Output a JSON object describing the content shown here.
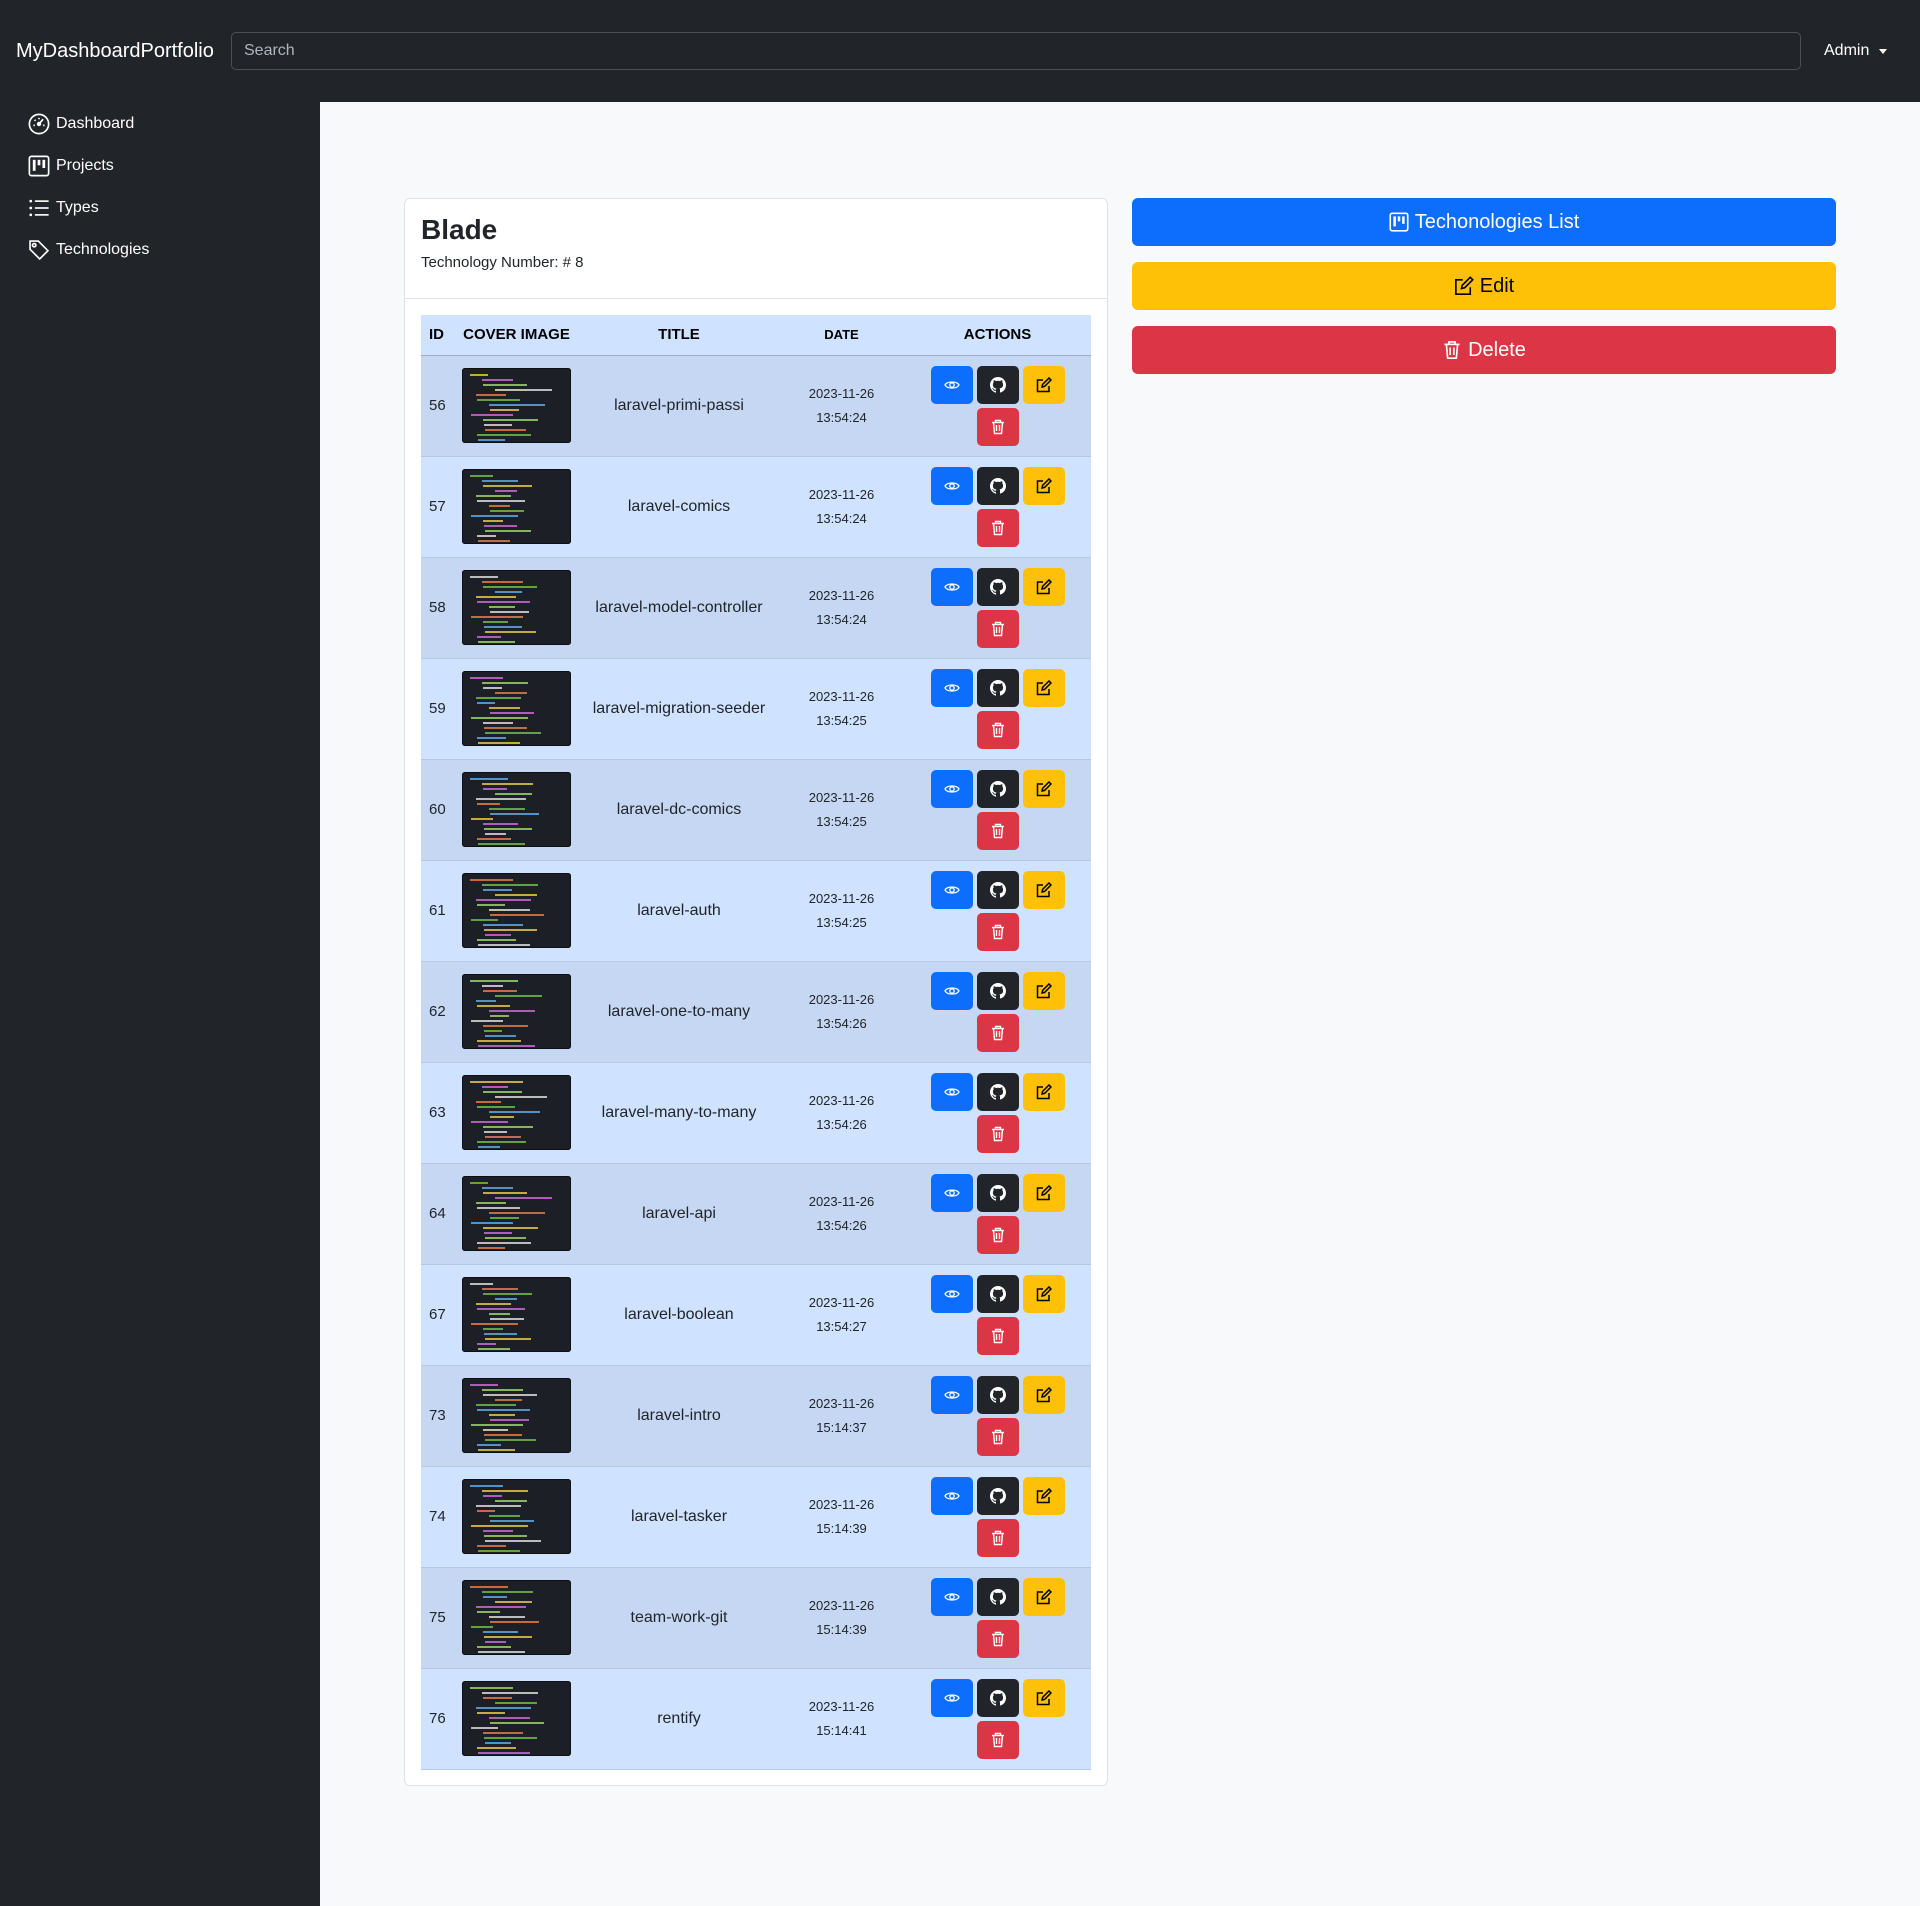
{
  "brand": "MyDashboardPortfolio",
  "search": {
    "placeholder": "Search"
  },
  "user_menu": {
    "label": "Admin"
  },
  "sidebar": {
    "items": [
      {
        "label": "Dashboard",
        "icon": "speedometer-icon"
      },
      {
        "label": "Projects",
        "icon": "kanban-icon"
      },
      {
        "label": "Types",
        "icon": "list-icon"
      },
      {
        "label": "Technologies",
        "icon": "tag-icon"
      }
    ]
  },
  "technology": {
    "name": "Blade",
    "number_label": "Technology Number:",
    "number_value": "# 8"
  },
  "table": {
    "headers": {
      "id": "ID",
      "cover": "COVER IMAGE",
      "title": "TITLE",
      "date": "DATE",
      "actions": "ACTIONS"
    },
    "rows": [
      {
        "id": "56",
        "title": "laravel-primi-passi",
        "date": "2023-11-26",
        "time": "13:54:24"
      },
      {
        "id": "57",
        "title": "laravel-comics",
        "date": "2023-11-26",
        "time": "13:54:24"
      },
      {
        "id": "58",
        "title": "laravel-model-controller",
        "date": "2023-11-26",
        "time": "13:54:24"
      },
      {
        "id": "59",
        "title": "laravel-migration-seeder",
        "date": "2023-11-26",
        "time": "13:54:25"
      },
      {
        "id": "60",
        "title": "laravel-dc-comics",
        "date": "2023-11-26",
        "time": "13:54:25"
      },
      {
        "id": "61",
        "title": "laravel-auth",
        "date": "2023-11-26",
        "time": "13:54:25"
      },
      {
        "id": "62",
        "title": "laravel-one-to-many",
        "date": "2023-11-26",
        "time": "13:54:26"
      },
      {
        "id": "63",
        "title": "laravel-many-to-many",
        "date": "2023-11-26",
        "time": "13:54:26"
      },
      {
        "id": "64",
        "title": "laravel-api",
        "date": "2023-11-26",
        "time": "13:54:26"
      },
      {
        "id": "67",
        "title": "laravel-boolean",
        "date": "2023-11-26",
        "time": "13:54:27"
      },
      {
        "id": "73",
        "title": "laravel-intro",
        "date": "2023-11-26",
        "time": "15:14:37"
      },
      {
        "id": "74",
        "title": "laravel-tasker",
        "date": "2023-11-26",
        "time": "15:14:39"
      },
      {
        "id": "75",
        "title": "team-work-git",
        "date": "2023-11-26",
        "time": "15:14:39"
      },
      {
        "id": "76",
        "title": "rentify",
        "date": "2023-11-26",
        "time": "15:14:41"
      }
    ]
  },
  "actions_panel": {
    "list_label": "Techonologies List",
    "edit_label": "Edit",
    "delete_label": "Delete"
  },
  "colors": {
    "primary": "#0d6efd",
    "warning": "#ffc107",
    "danger": "#dc3545",
    "dark": "#212529",
    "table_bg": "#cfe2ff"
  }
}
